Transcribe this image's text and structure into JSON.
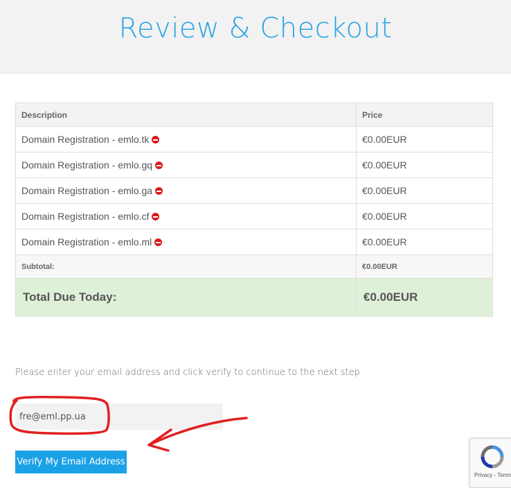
{
  "page": {
    "title": "Review & Checkout"
  },
  "cart": {
    "headers": {
      "description": "Description",
      "price": "Price"
    },
    "items": [
      {
        "description": "Domain Registration - emlo.tk",
        "price": "€0.00EUR"
      },
      {
        "description": "Domain Registration - emlo.gq",
        "price": "€0.00EUR"
      },
      {
        "description": "Domain Registration - emlo.ga",
        "price": "€0.00EUR"
      },
      {
        "description": "Domain Registration - emlo.cf",
        "price": "€0.00EUR"
      },
      {
        "description": "Domain Registration - emlo.ml",
        "price": "€0.00EUR"
      }
    ],
    "subtotal": {
      "label": "Subtotal:",
      "value": "€0.00EUR"
    },
    "total": {
      "label": "Total Due Today:",
      "value": "€0.00EUR"
    }
  },
  "verify": {
    "instructions": "Please enter your email address and click verify to continue to the next step",
    "email_value": "fre@eml.pp.ua",
    "button_label": "Verify My Email Address"
  },
  "recaptcha": {
    "links": "Privacy - Terms"
  },
  "colors": {
    "accent": "#2ba3e3",
    "button": "#1ba2e6",
    "total_bg": "#dff0d8",
    "remove": "#d9191c",
    "annotation": "#e02020"
  },
  "icons": {
    "remove": "remove-circle-icon",
    "recaptcha": "recaptcha-logo-icon"
  }
}
